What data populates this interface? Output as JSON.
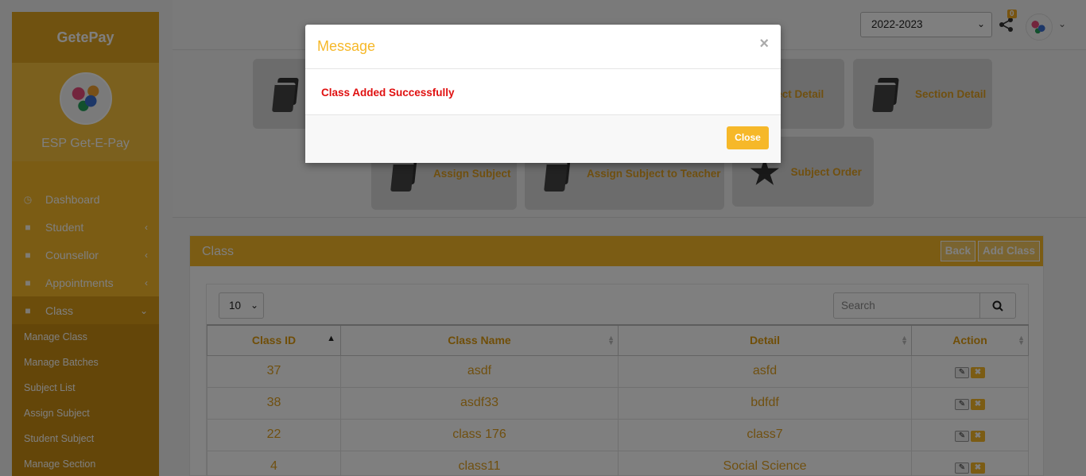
{
  "brand": "GetePay",
  "profile_name": "ESP Get-E-Pay",
  "nav": [
    {
      "label": "Dashboard",
      "icon": "dashboard-icon"
    },
    {
      "label": "Student",
      "icon": "graduation-cap-icon"
    },
    {
      "label": "Counsellor",
      "icon": "graduation-cap-icon"
    },
    {
      "label": "Appointments",
      "icon": "graduation-cap-icon"
    },
    {
      "label": "Class",
      "icon": "graduation-cap-icon"
    }
  ],
  "subnav": [
    "Manage Class",
    "Manage Batches",
    "Subject List",
    "Assign Subject",
    "Student Subject",
    "Manage Section"
  ],
  "header": {
    "year": "2022-2023",
    "notification_count": "0"
  },
  "tiles": {
    "subject_detail": "Subject Detail",
    "section_detail": "Section Detail",
    "assign_subject": "Assign Subject",
    "assign_subject_teacher": "Assign Subject to Teacher",
    "subject_order": "Subject Order"
  },
  "panel": {
    "title": "Class",
    "back_label": "Back",
    "add_label": "Add Class",
    "page_length": "10",
    "search_placeholder": "Search"
  },
  "table": {
    "headers": [
      "Class ID",
      "Class Name",
      "Detail",
      "Action"
    ],
    "rows": [
      {
        "id": "37",
        "name": "asdf",
        "detail": "asfd"
      },
      {
        "id": "38",
        "name": "asdf33",
        "detail": "bdfdf"
      },
      {
        "id": "22",
        "name": "class 176",
        "detail": "class7"
      },
      {
        "id": "4",
        "name": "class11",
        "detail": "Social Science"
      }
    ]
  },
  "modal": {
    "title": "Message",
    "message": "Class Added Successfully",
    "close_label": "Close"
  },
  "colors": {
    "accent": "#f6b829",
    "error": "#e01010"
  }
}
